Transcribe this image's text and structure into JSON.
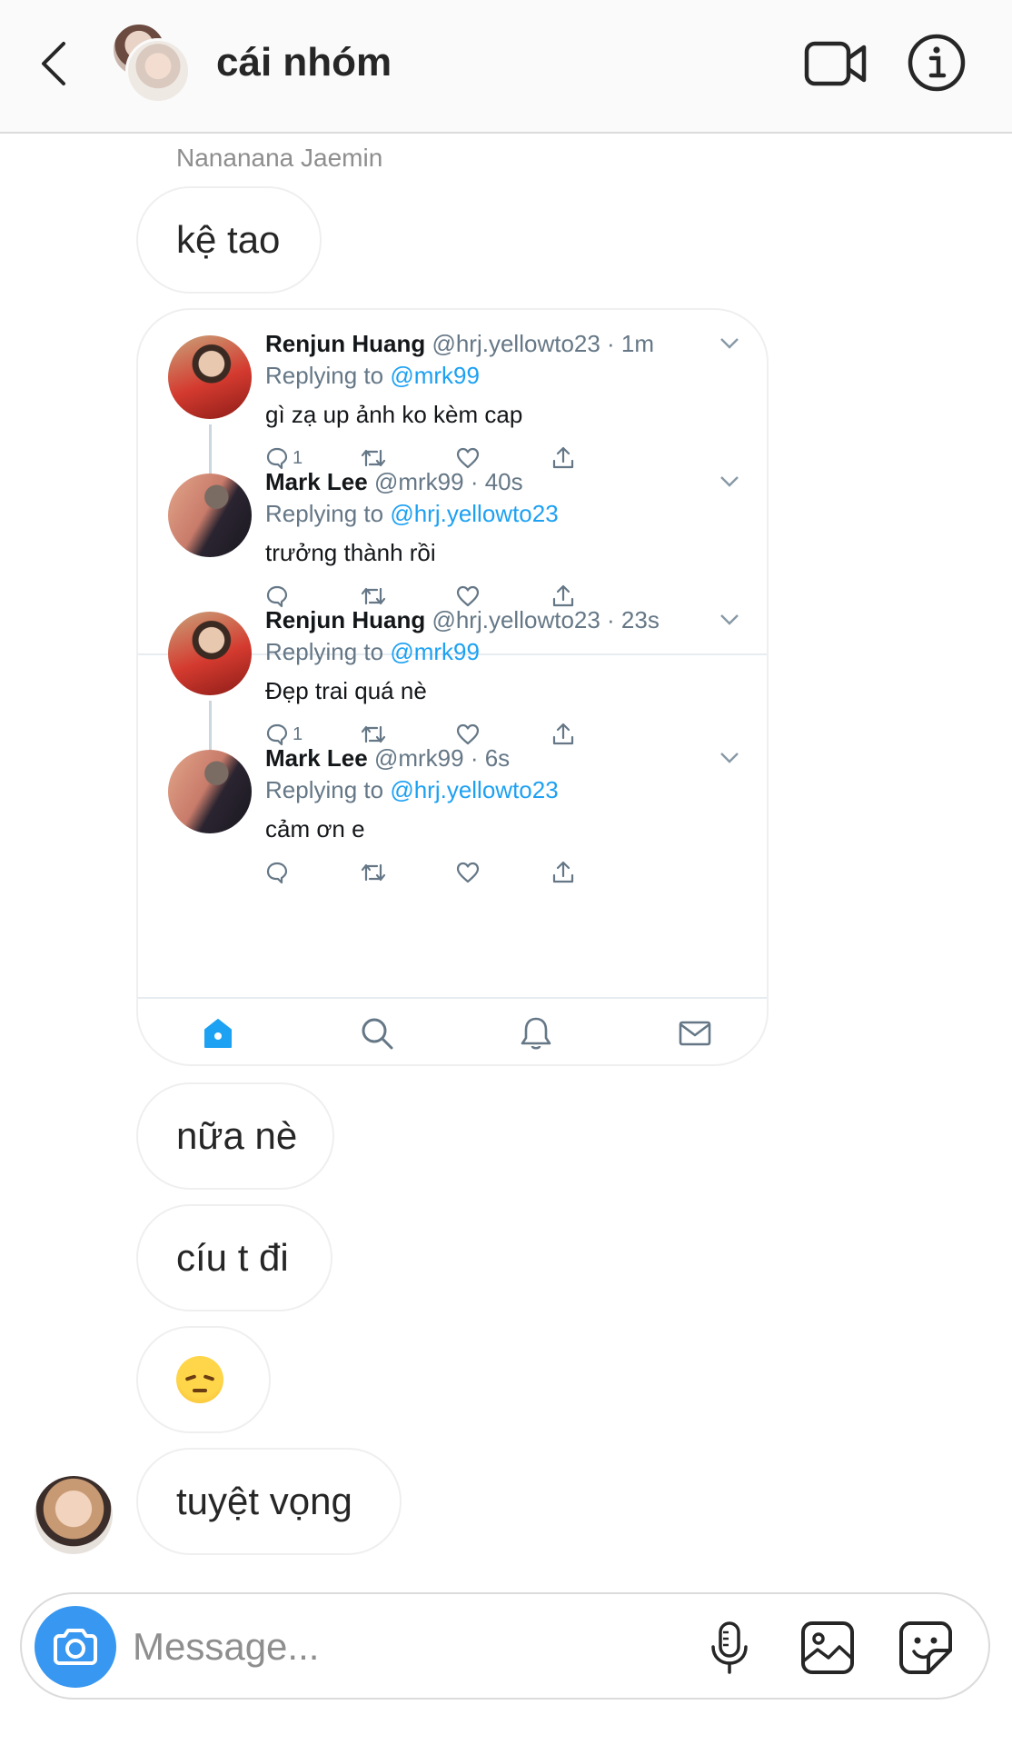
{
  "header": {
    "title": "cái nhóm"
  },
  "messages": {
    "sender_name": "Nananana Jaemin",
    "items": [
      {
        "text": "kệ tao"
      },
      {
        "text": "nữa nè"
      },
      {
        "text": "cíu t đi"
      },
      {
        "emoji": "pensive-face"
      },
      {
        "text": "tuyệt vọng"
      }
    ]
  },
  "shared_screenshot": {
    "tweets": [
      {
        "name": "Renjun Huang",
        "meta": "@hrj.yellowto23 · 1m",
        "replying_prefix": "Replying to",
        "replying_handle": "@mrk99",
        "text": "gì zạ up ảnh ko kèm cap",
        "reply_count": "1"
      },
      {
        "name": "Mark Lee",
        "meta": "@mrk99 · 40s",
        "replying_prefix": "Replying to",
        "replying_handle": "@hrj.yellowto23",
        "text": "trưởng thành rồi",
        "reply_count": ""
      },
      {
        "name": "Renjun Huang",
        "meta": "@hrj.yellowto23 · 23s",
        "replying_prefix": "Replying to",
        "replying_handle": "@mrk99",
        "text": "Đẹp trai quá nè",
        "reply_count": "1"
      },
      {
        "name": "Mark Lee",
        "meta": "@mrk99 · 6s",
        "replying_prefix": "Replying to",
        "replying_handle": "@hrj.yellowto23",
        "text": "cảm ơn e",
        "reply_count": ""
      }
    ],
    "tabs": [
      "home-icon",
      "search-icon",
      "bell-icon",
      "mail-icon"
    ],
    "accent": "#1da1f2"
  },
  "composer": {
    "placeholder": "Message..."
  },
  "colors": {
    "header_bg": "#fafafa",
    "bubble_border": "#efefef",
    "camera_button": "#3897f0",
    "twitter_link": "#1da1f2"
  }
}
